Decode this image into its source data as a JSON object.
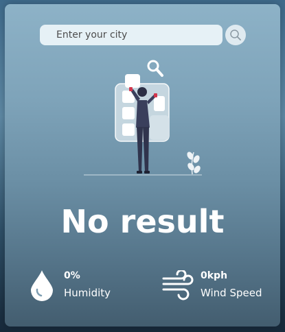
{
  "search": {
    "placeholder": "Enter your city",
    "button_icon": "search-icon"
  },
  "illustration": {
    "name": "person-searching-illustration",
    "icons": [
      "magnifier-icon",
      "plant-icon"
    ]
  },
  "result": {
    "text": "No result"
  },
  "humidity": {
    "value": "0%",
    "label": "Humidity",
    "icon": "water-drop-icon"
  },
  "wind": {
    "value": "0kph",
    "label": "Wind Speed",
    "icon": "wind-icon"
  },
  "colors": {
    "card_top": "#8db2c7",
    "card_bottom": "#435d6f",
    "search_field": "#e6f1f6",
    "text": "#ffffff",
    "figure": "#3a3f5c",
    "accent": "#d2374d"
  }
}
